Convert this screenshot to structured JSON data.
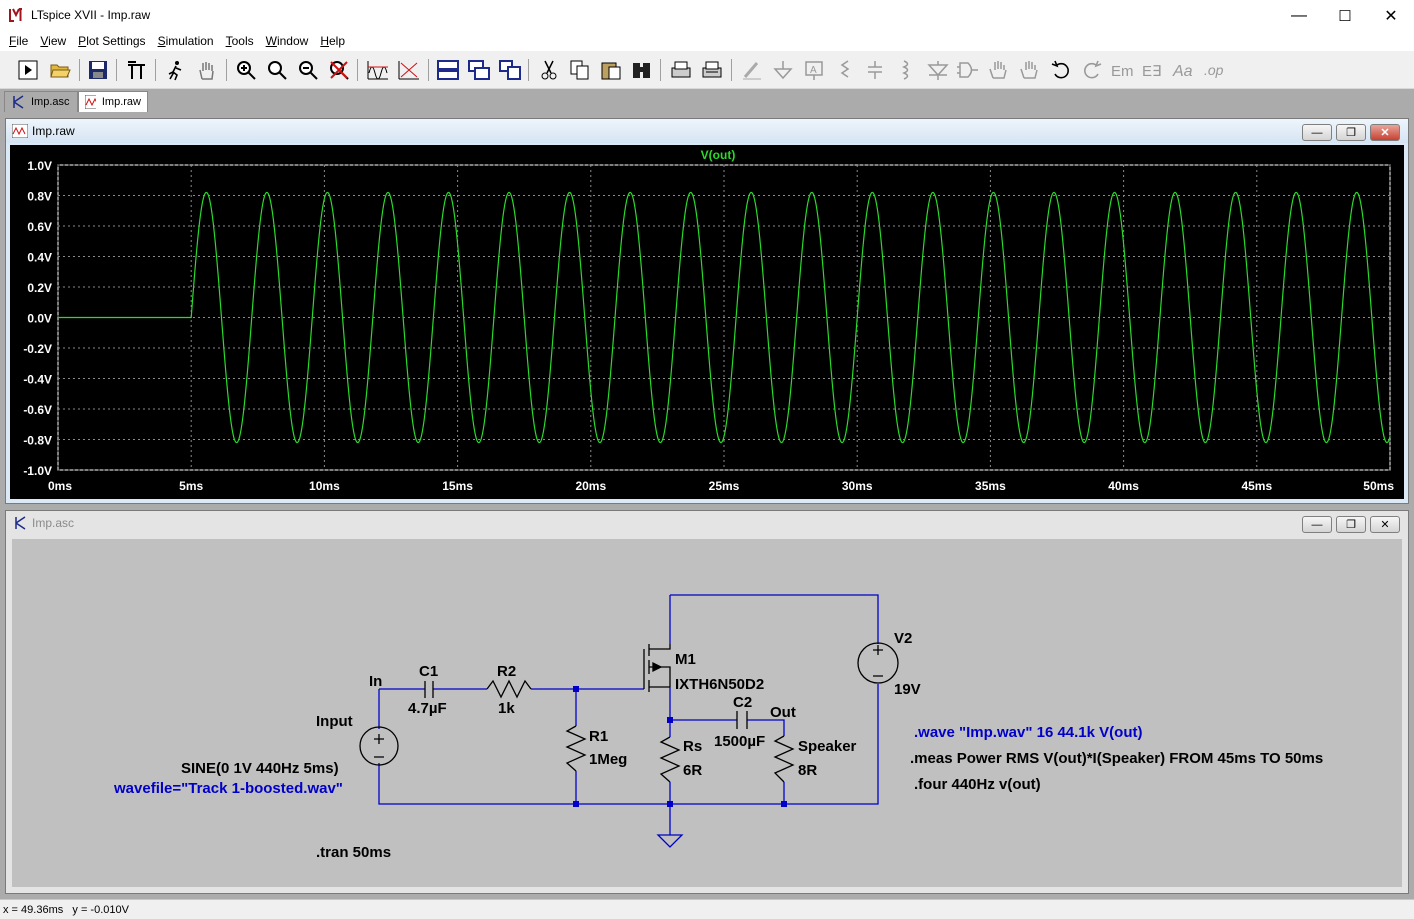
{
  "app": {
    "title": "LTspice XVII - Imp.raw"
  },
  "window_controls": {
    "minimize": "—",
    "maximize": "☐",
    "close": "✕"
  },
  "menu": [
    {
      "label": "File",
      "ul": "F",
      "rest": "ile"
    },
    {
      "label": "View",
      "ul": "V",
      "rest": "iew"
    },
    {
      "label": "Plot Settings",
      "ul": "P",
      "rest": "lot Settings"
    },
    {
      "label": "Simulation",
      "ul": "S",
      "rest": "imulation"
    },
    {
      "label": "Tools",
      "ul": "T",
      "rest": "ools"
    },
    {
      "label": "Window",
      "ul": "W",
      "rest": "indow"
    },
    {
      "label": "Help",
      "ul": "H",
      "rest": "elp"
    }
  ],
  "toolbar_icons": [
    "run-icon",
    "open-icon",
    "save-icon",
    "control-panel-icon",
    "halt-icon",
    "pan-icon",
    "zoom-in-icon",
    "zoom-box-icon",
    "zoom-out-icon",
    "zoom-fit-icon",
    "autorange-icon",
    "mark-unused-icon",
    "tile-horizontal-icon",
    "cascade-icon",
    "tile-vertical-icon",
    "cut-icon",
    "copy-icon",
    "paste-icon",
    "find-icon",
    "print-icon",
    "print-setup-icon",
    "wire-icon",
    "ground-icon",
    "label-net-icon",
    "resistor-icon",
    "capacitor-icon",
    "inductor-icon",
    "diode-icon",
    "component-icon",
    "move-icon",
    "drag-icon",
    "undo-icon",
    "redo-icon",
    "rotate-icon",
    "mirror-icon",
    "text-icon",
    "spice-directive-icon"
  ],
  "tabs": [
    {
      "label": "Imp.asc",
      "active": false
    },
    {
      "label": "Imp.raw",
      "active": true
    }
  ],
  "waveform_window": {
    "title": "Imp.raw",
    "trace_label": "V(out)",
    "trace_color": "#2bd92b",
    "y_ticks": [
      "1.0V",
      "0.8V",
      "0.6V",
      "0.4V",
      "0.2V",
      "0.0V",
      "-0.2V",
      "-0.4V",
      "-0.6V",
      "-0.8V",
      "-1.0V"
    ],
    "x_ticks": [
      "0ms",
      "5ms",
      "10ms",
      "15ms",
      "20ms",
      "25ms",
      "30ms",
      "35ms",
      "40ms",
      "45ms",
      "50ms"
    ]
  },
  "chart_data": {
    "type": "line",
    "title": "",
    "series": [
      {
        "name": "V(out)",
        "start_ms": 5,
        "amplitude_v": 0.82,
        "frequency_hz": 440,
        "before_start_v": 0.0
      }
    ],
    "xlabel": "",
    "ylabel": "",
    "xlim": [
      0,
      50
    ],
    "ylim": [
      -1.0,
      1.0
    ],
    "grid": true
  },
  "schematic_window": {
    "title": "Imp.asc",
    "labels": {
      "in": "In",
      "input": "Input",
      "sine": "SINE(0 1V 440Hz 5ms)",
      "wavefile": "wavefile=\"Track 1-boosted.wav\"",
      "c1": "C1",
      "c1_val": "4.7µF",
      "r2": "R2",
      "r2_val": "1k",
      "r1": "R1",
      "r1_val": "1Meg",
      "m1": "M1",
      "m1_val": "IXTH6N50D2",
      "rs": "Rs",
      "rs_val": "6R",
      "c2": "C2",
      "c2_val": "1500µF",
      "out": "Out",
      "speaker": "Speaker",
      "speaker_val": "8R",
      "v2": "V2",
      "v2_val": "19V",
      "tran": ".tran 50ms",
      "wave": ".wave \"Imp.wav\" 16 44.1k V(out)",
      "meas": ".meas Power RMS V(out)*I(Speaker) FROM 45ms TO 50ms",
      "four": ".four 440Hz v(out)"
    }
  },
  "status": {
    "text": "x = 49.36ms   y = -0.010V"
  }
}
